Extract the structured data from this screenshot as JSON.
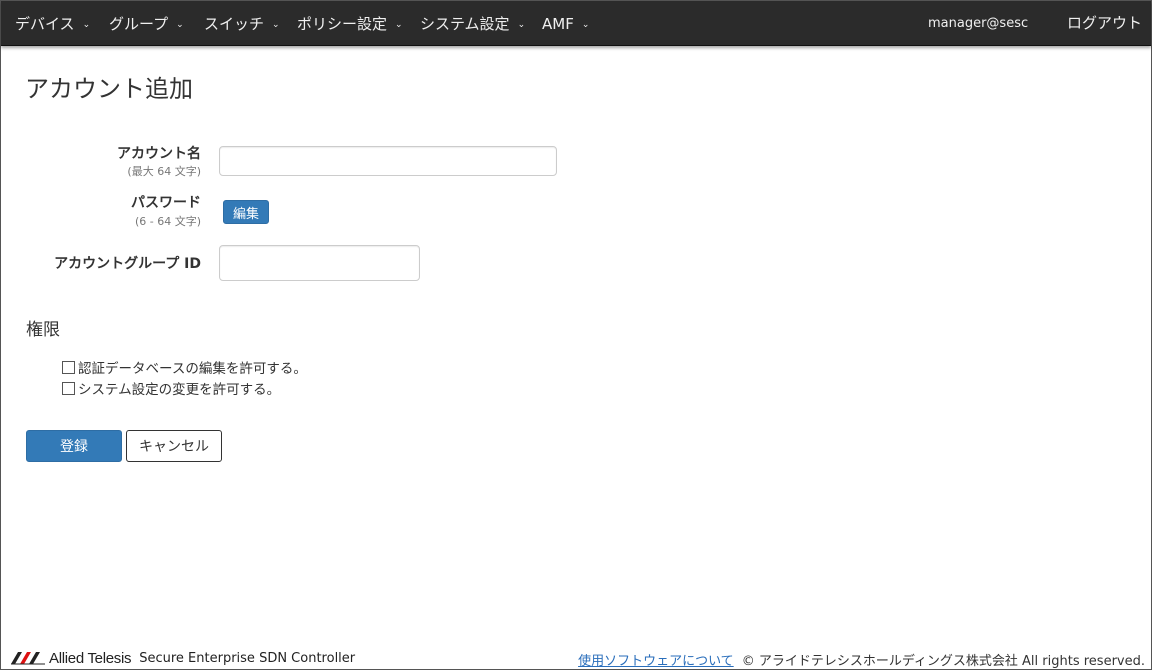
{
  "navbar": {
    "items": [
      {
        "label": "デバイス"
      },
      {
        "label": "グループ"
      },
      {
        "label": "スイッチ"
      },
      {
        "label": "ポリシー設定"
      },
      {
        "label": "システム設定"
      },
      {
        "label": "AMF"
      }
    ],
    "user": "manager@sesc",
    "logout": "ログアウト"
  },
  "page": {
    "title": "アカウント追加"
  },
  "form": {
    "account_name_label": "アカウント名",
    "account_name_hint": "(最大 64 文字)",
    "account_name_value": "",
    "password_label": "パスワード",
    "password_hint": "(6 - 64 文字)",
    "password_edit": "編集",
    "group_id_label": "アカウントグループ ID",
    "group_id_value": ""
  },
  "permissions": {
    "title": "権限",
    "items": [
      {
        "label": "認証データベースの編集を許可する。",
        "checked": false
      },
      {
        "label": "システム設定の変更を許可する。",
        "checked": false
      }
    ]
  },
  "actions": {
    "submit": "登録",
    "cancel": "キャンセル"
  },
  "footer": {
    "brand": "Allied Telesis",
    "product": "Secure Enterprise SDN Controller",
    "about_link": "使用ソフトウェアについて",
    "copyright": "© アライドテレシスホールディングス株式会社 All rights reserved."
  },
  "colors": {
    "navbar_bg": "#2b2b2b",
    "primary": "#337ab7",
    "link": "#2a6ebb"
  }
}
